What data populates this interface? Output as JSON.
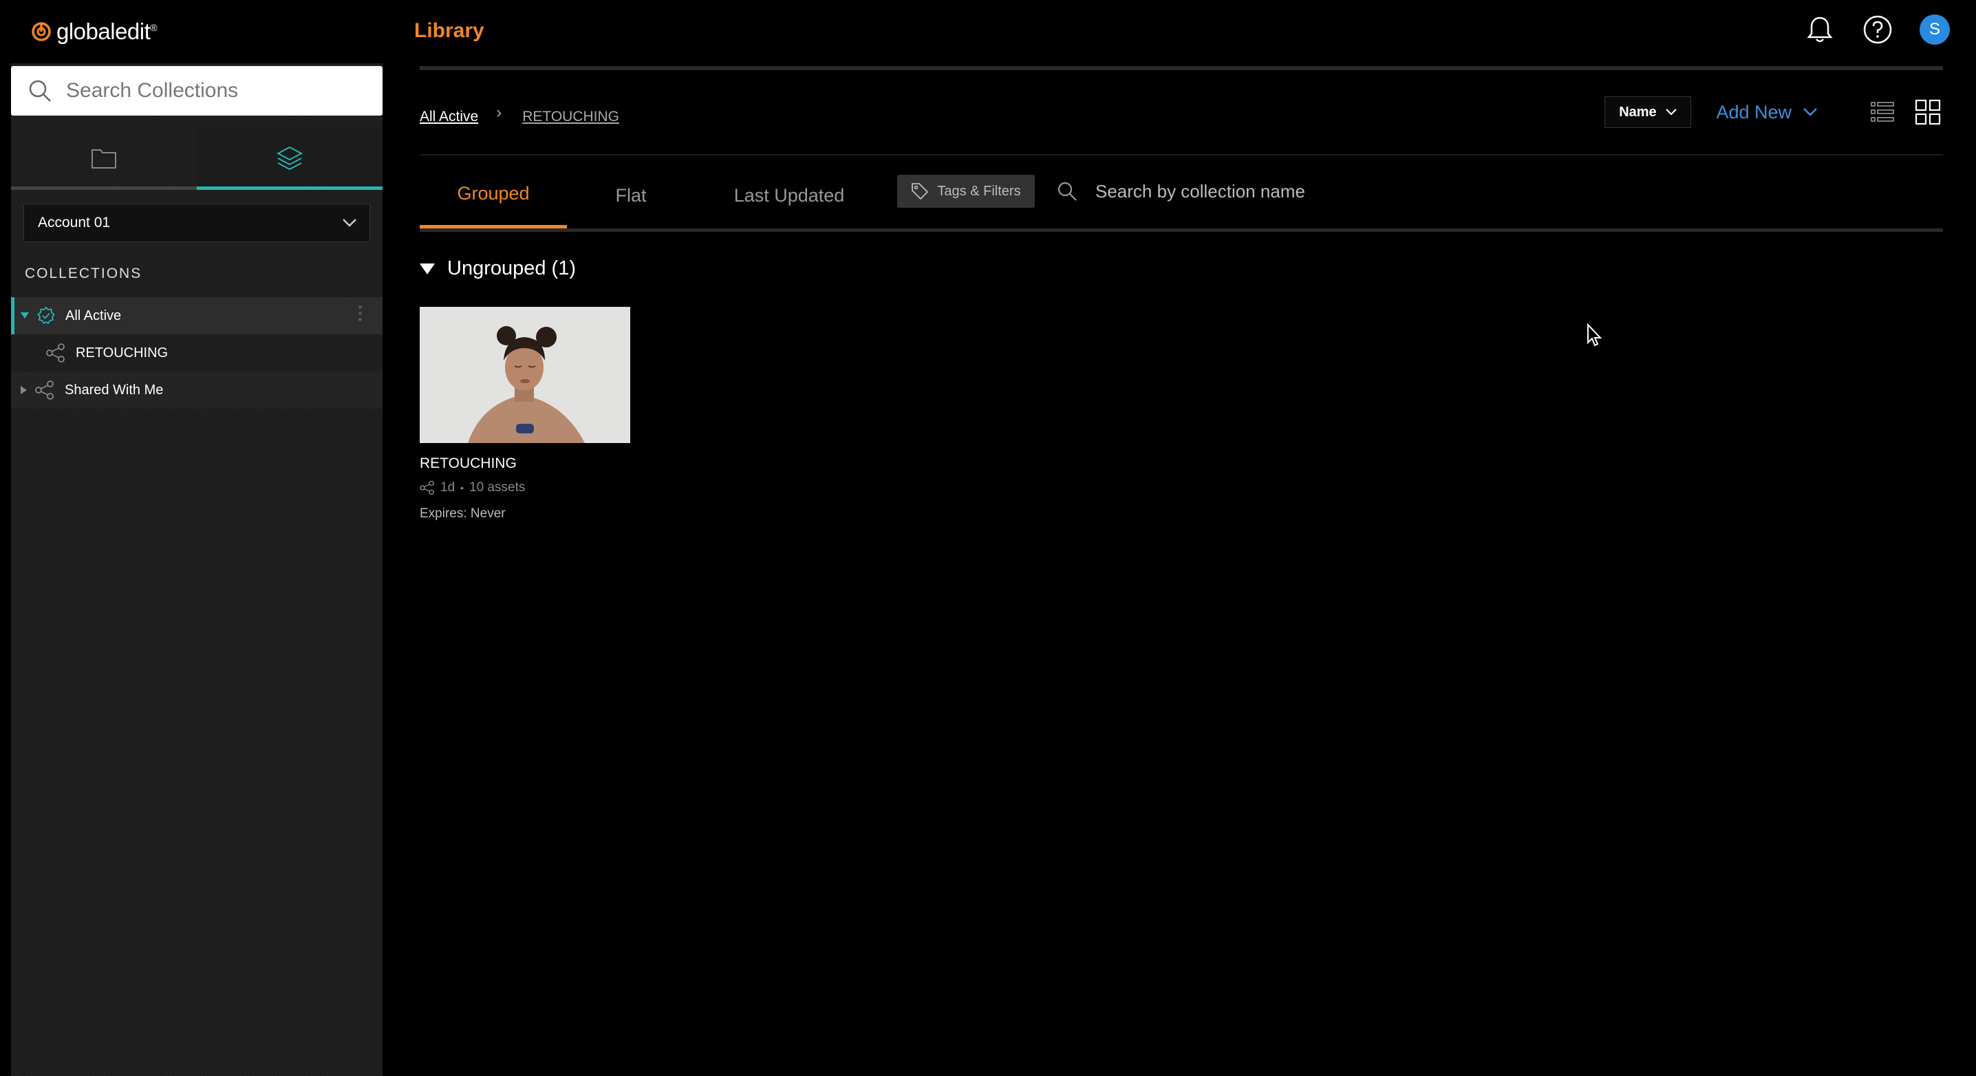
{
  "app": {
    "logo_text": "globaledit",
    "logo_mark": "®",
    "page_title": "Library",
    "avatar_initial": "S",
    "accent_color": "#f0862a",
    "teal_color": "#2ab3b0",
    "link_color": "#3d8fe0"
  },
  "icons": {
    "notifications": "bell-icon",
    "help": "question-circle-icon",
    "search": "search-icon",
    "folder": "folder-icon",
    "collections": "layers-icon",
    "share": "share-icon",
    "tag": "tag-icon"
  },
  "sidebar": {
    "search_placeholder": "Search Collections",
    "account": "Account 01",
    "section_label": "COLLECTIONS",
    "items": [
      {
        "label": "All Active",
        "expanded": true,
        "selected": true
      },
      {
        "label": "RETOUCHING",
        "child": true
      },
      {
        "label": "Shared With Me",
        "expanded": false
      }
    ]
  },
  "breadcrumb": {
    "root": "All Active",
    "separator": "›",
    "current": "RETOUCHING"
  },
  "toolbar": {
    "sort_label": "Name",
    "add_new_label": "Add New"
  },
  "tabs": [
    {
      "label": "Grouped",
      "active": true
    },
    {
      "label": "Flat",
      "active": false
    },
    {
      "label": "Last Updated",
      "active": false
    }
  ],
  "filters": {
    "tags_label": "Tags & Filters",
    "search_placeholder": "Search by collection name"
  },
  "group": {
    "label": "Ungrouped (1)"
  },
  "cards": [
    {
      "title": "RETOUCHING",
      "age": "1d",
      "assets": "10 assets",
      "expiry": "Expires: Never"
    }
  ]
}
